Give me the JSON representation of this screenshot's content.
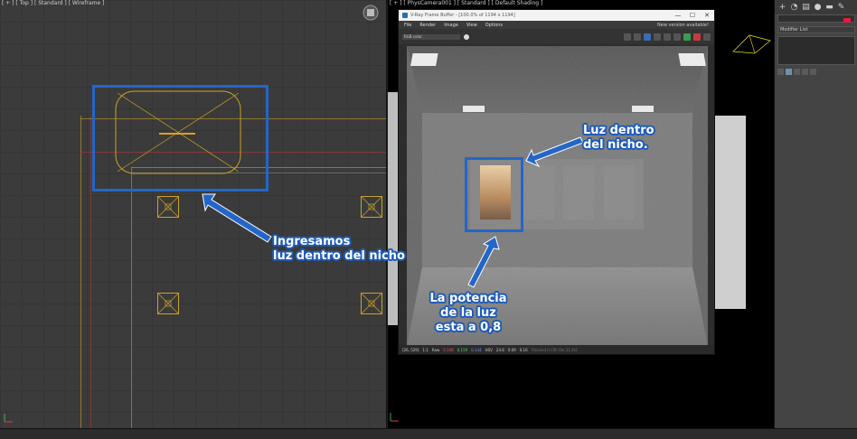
{
  "viewports": {
    "left_label": "[ + ] [ Top ] [ Standard ] [ Wireframe ]",
    "right_label": "[ + ] [ PhysCamera001 ] [ Standard ] [ Default Shading ]"
  },
  "vfb": {
    "title": "V-Ray Frame Buffer - [100.0% of 1194 x 1194]",
    "win_controls": [
      "—",
      "☐",
      "✕"
    ],
    "menu": [
      "File",
      "Render",
      "Image",
      "View",
      "Options"
    ],
    "notice": "New version available!",
    "channel": "RGB color",
    "status": {
      "coords": "[26, 529]",
      "zoom": "1:1",
      "mode": "Raw",
      "r": "0.108",
      "g": "0.159",
      "b": "0.144",
      "space": "HSV",
      "h": "24.8",
      "s": "0.09",
      "v": "0.16",
      "info": "Finished in [0h 0m 21.4s]"
    }
  },
  "command_panel": {
    "tab_icons": [
      "plus-icon",
      "modify-icon",
      "hierarchy-icon",
      "motion-icon",
      "display-icon",
      "utilities-icon"
    ],
    "modifier_list": "Modifier List"
  },
  "annotations": {
    "left": [
      "Ingresamos",
      "luz dentro del nicho"
    ],
    "top_right": [
      "Luz dentro",
      "del nicho."
    ],
    "bottom": [
      "La potencia",
      "de la luz",
      "esta a 0,8"
    ]
  },
  "colors": {
    "annotation_blue": "#2366c9",
    "wireframe_yellow": "#c9a227",
    "wireframe_red": "#b83a3a",
    "niche_light": "#e8b77a"
  }
}
